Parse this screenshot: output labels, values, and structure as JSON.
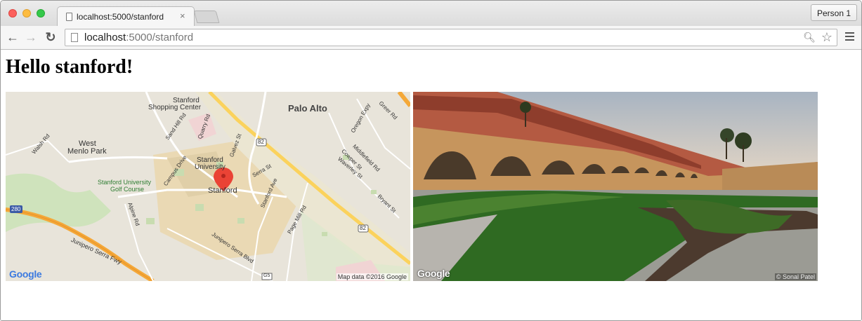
{
  "browser": {
    "tab_title": "localhost:5000/stanford",
    "tab_close": "×",
    "profile_button": "Person 1",
    "url_host": "localhost",
    "url_rest": ":5000/stanford",
    "nav": {
      "back": "←",
      "forward": "→",
      "reload": "↻"
    }
  },
  "page": {
    "heading": "Hello stanford!"
  },
  "map": {
    "labels": {
      "stanford_shopping": "Stanford",
      "shopping_center": "Shopping Center",
      "palo_alto": "Palo Alto",
      "west": "West",
      "menlo_park": "Menlo Park",
      "stanford_univ": "Stanford",
      "university": "University",
      "stanford": "Stanford",
      "golf1": "Stanford University",
      "golf2": "Golf Course",
      "walsh_rd": "Walsh Rd",
      "sand_hill": "Sand Hill Rd",
      "quarry_rd": "Quarry Rd",
      "galvez": "Galvez St",
      "oregon": "Oregon Expy",
      "greer": "Greer Rd",
      "middlefield": "Middlefield Rd",
      "cowper": "Cowper St",
      "waverley": "Waverley St",
      "serra": "Serra St",
      "campus": "Campus Drive",
      "alpine": "Alpine Rd",
      "stanford_ave": "Stanford Ave",
      "page_mill": "Page Mill Rd",
      "bryant": "Bryant St",
      "junipero_fwy": "Junipero Serra Fwy",
      "junipero_blvd": "Junipero Serra Blvd",
      "r280": "280",
      "r82a": "82",
      "r82b": "82",
      "g5": "G5"
    },
    "attribution": "Map data ©2016 Google",
    "logo": "Google"
  },
  "street": {
    "logo": "Google",
    "attribution": "© Sonal Patel"
  }
}
